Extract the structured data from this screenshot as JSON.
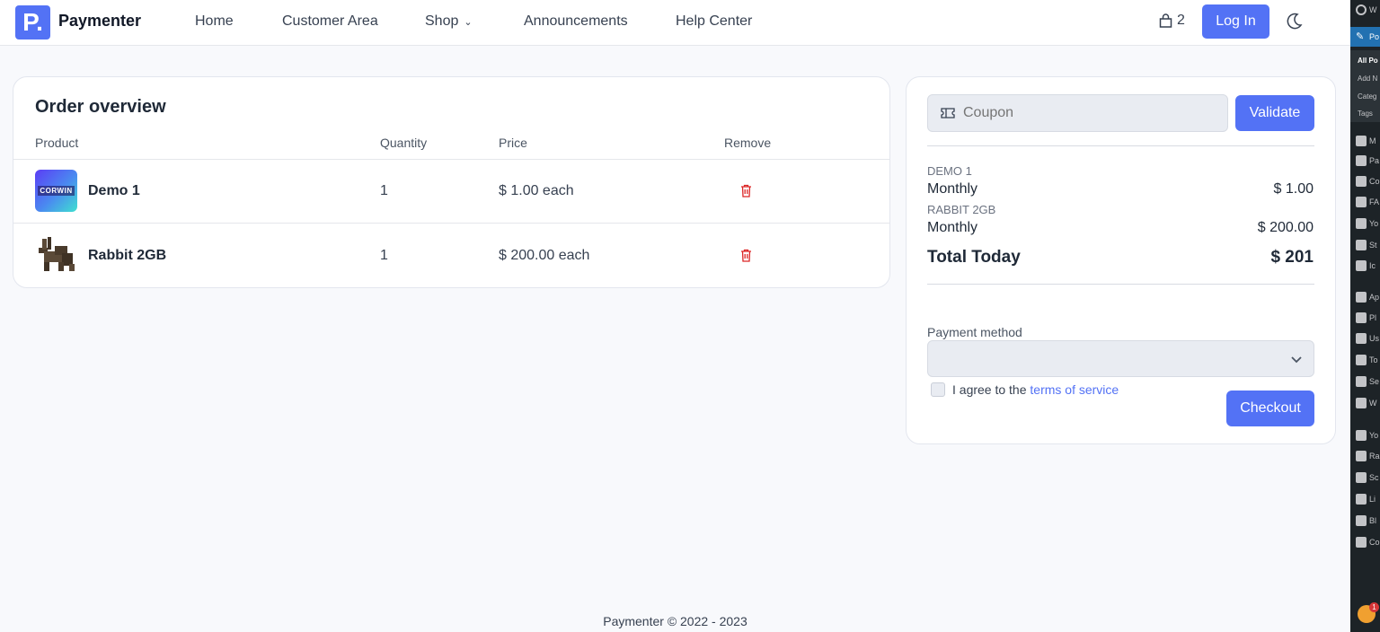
{
  "brand": {
    "logo_letter": "P.",
    "name": "Paymenter",
    "accent": "#5372f5"
  },
  "nav": {
    "links": [
      "Home",
      "Customer Area",
      "Shop",
      "Announcements",
      "Help Center"
    ],
    "cart_count": "2",
    "login_label": "Log In"
  },
  "order": {
    "title": "Order overview",
    "columns": [
      "Product",
      "Quantity",
      "Price",
      "Remove"
    ],
    "rows": [
      {
        "name": "Demo 1",
        "quantity": "1",
        "price": "$ 1.00 each",
        "thumb_text": "CORWIN"
      },
      {
        "name": "Rabbit 2GB",
        "quantity": "1",
        "price": "$ 200.00 each"
      }
    ]
  },
  "summary": {
    "coupon_placeholder": "Coupon",
    "validate_label": "Validate",
    "items": [
      {
        "name": "DEMO 1",
        "period": "Monthly",
        "price": "$ 1.00"
      },
      {
        "name": "RABBIT 2GB",
        "period": "Monthly",
        "price": "$ 200.00"
      }
    ],
    "total_label": "Total Today",
    "total_value": "$ 201",
    "payment_method_label": "Payment method",
    "agree_prefix": "I agree to the ",
    "agree_link": "terms of service",
    "checkout_label": "Checkout"
  },
  "footer": {
    "text": "Paymenter © 2022 - 2023"
  },
  "wp_sidebar": {
    "top_item": "W",
    "active_item": "Po",
    "sub_items": [
      "All Po",
      "Add N",
      "Categ",
      "Tags"
    ],
    "items": [
      "M",
      "Pa",
      "Co",
      "FA",
      "Yo",
      "St",
      "Ic",
      "Ap",
      "Pl",
      "Us",
      "To",
      "Se",
      "W",
      "Yo",
      "Ra",
      "Sc",
      "Li",
      "Bl",
      "Co"
    ],
    "notification_count": "1"
  }
}
